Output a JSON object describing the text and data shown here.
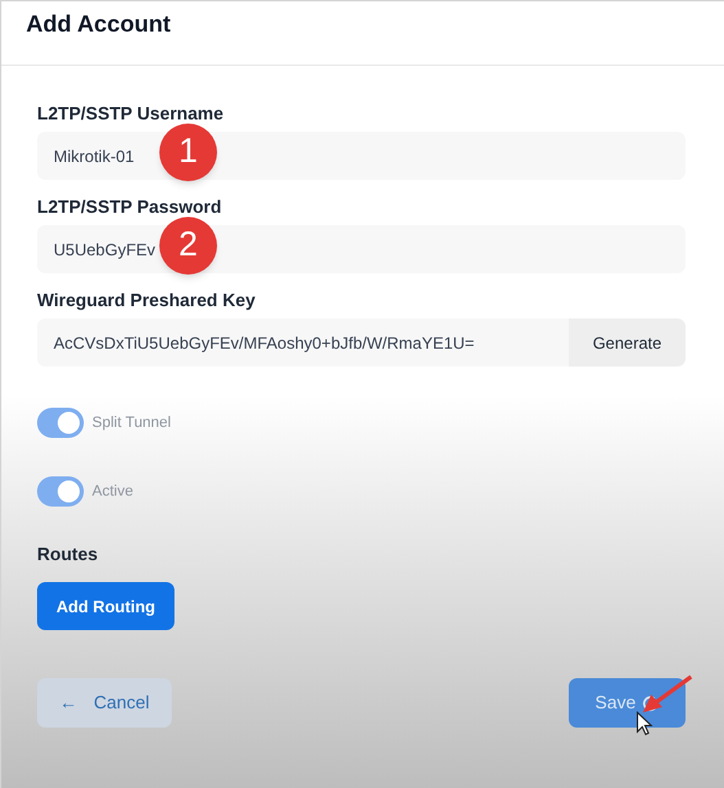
{
  "dialog": {
    "title": "Add Account"
  },
  "fields": [
    {
      "label": "L2TP/SSTP Username",
      "value": "Mikrotik-01",
      "marker": "1"
    },
    {
      "label": "L2TP/SSTP Password",
      "value": "U5UebGyFEv",
      "marker": "2"
    },
    {
      "label": "Wireguard Preshared Key",
      "value": "AcCVsDxTiU5UebGyFEv/MFAoshy0+bJfb/W/RmaYE1U=",
      "button": "Generate"
    }
  ],
  "toggles": [
    {
      "label": "Split Tunnel",
      "on": true,
      "disabled": true
    },
    {
      "label": "Active",
      "on": true,
      "disabled": true
    }
  ],
  "routes": {
    "label": "Routes",
    "button": "Add Routing"
  },
  "footer": {
    "cancel": {
      "icon": "←",
      "label": "Cancel"
    },
    "save": {
      "label": "Save",
      "loading": true
    }
  }
}
